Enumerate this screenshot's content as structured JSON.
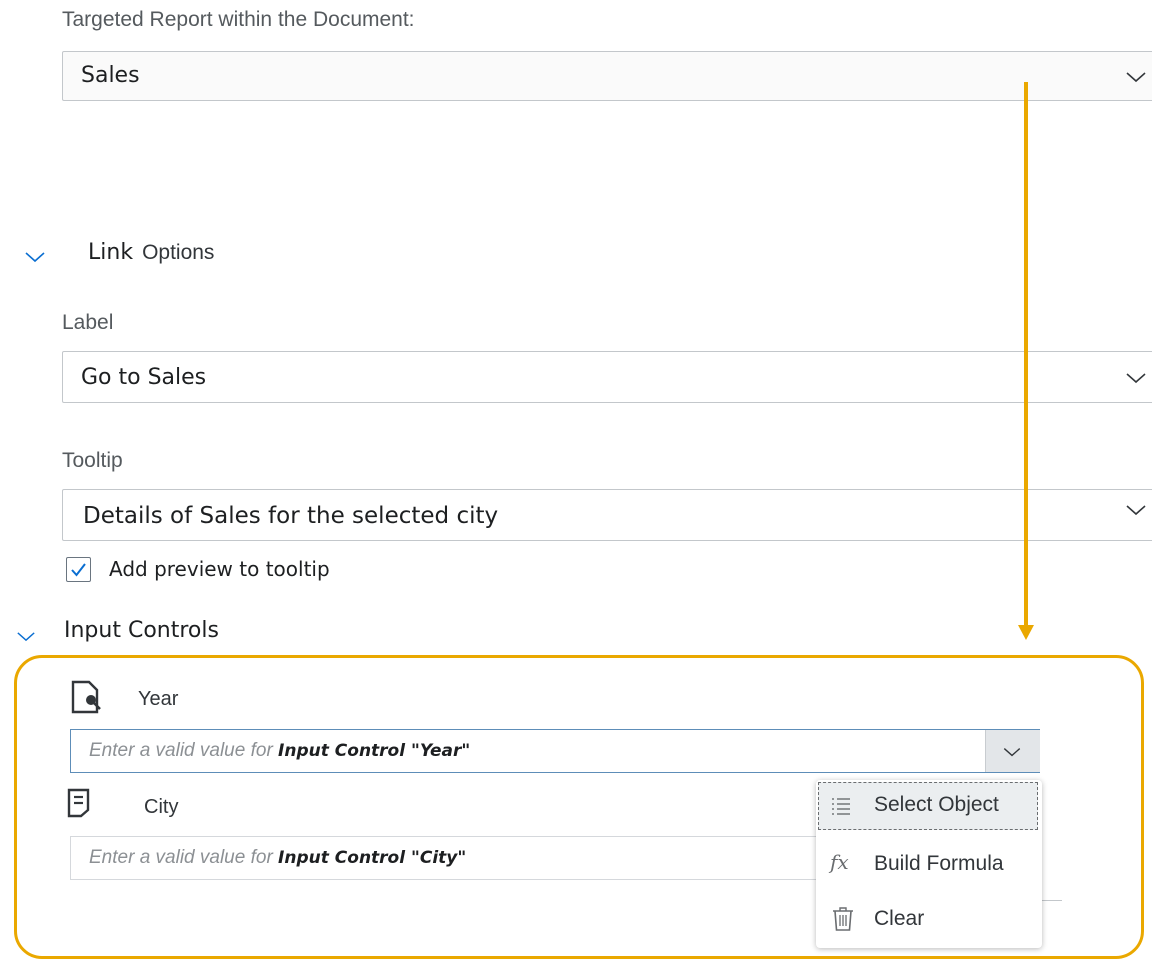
{
  "targeted_report": {
    "label": "Targeted Report within the Document:",
    "value": "Sales"
  },
  "link_options": {
    "title_bold": "Link",
    "title_rest": "Options",
    "label_field": {
      "label": "Label",
      "value": "Go to Sales"
    },
    "tooltip_field": {
      "label": "Tooltip",
      "value": "Details of Sales for the selected city"
    },
    "preview_checkbox": {
      "label": "Add preview to tooltip",
      "checked": true
    }
  },
  "input_controls": {
    "title": "Input Controls",
    "items": [
      {
        "name": "Year",
        "placeholder_prefix": "Enter a valid value for",
        "placeholder_target": "Input Control \"Year\""
      },
      {
        "name": "City",
        "placeholder_prefix": "Enter a valid value for",
        "placeholder_target": "Input Control \"City\""
      }
    ]
  },
  "dropdown_menu": {
    "items": [
      {
        "label": "Select Object",
        "icon": "list-icon"
      },
      {
        "label": "Build Formula",
        "icon": "formula-icon"
      },
      {
        "label": "Clear",
        "icon": "trash-icon"
      }
    ]
  },
  "colors": {
    "highlight": "#eaa800",
    "accent": "#0a6ed1"
  }
}
